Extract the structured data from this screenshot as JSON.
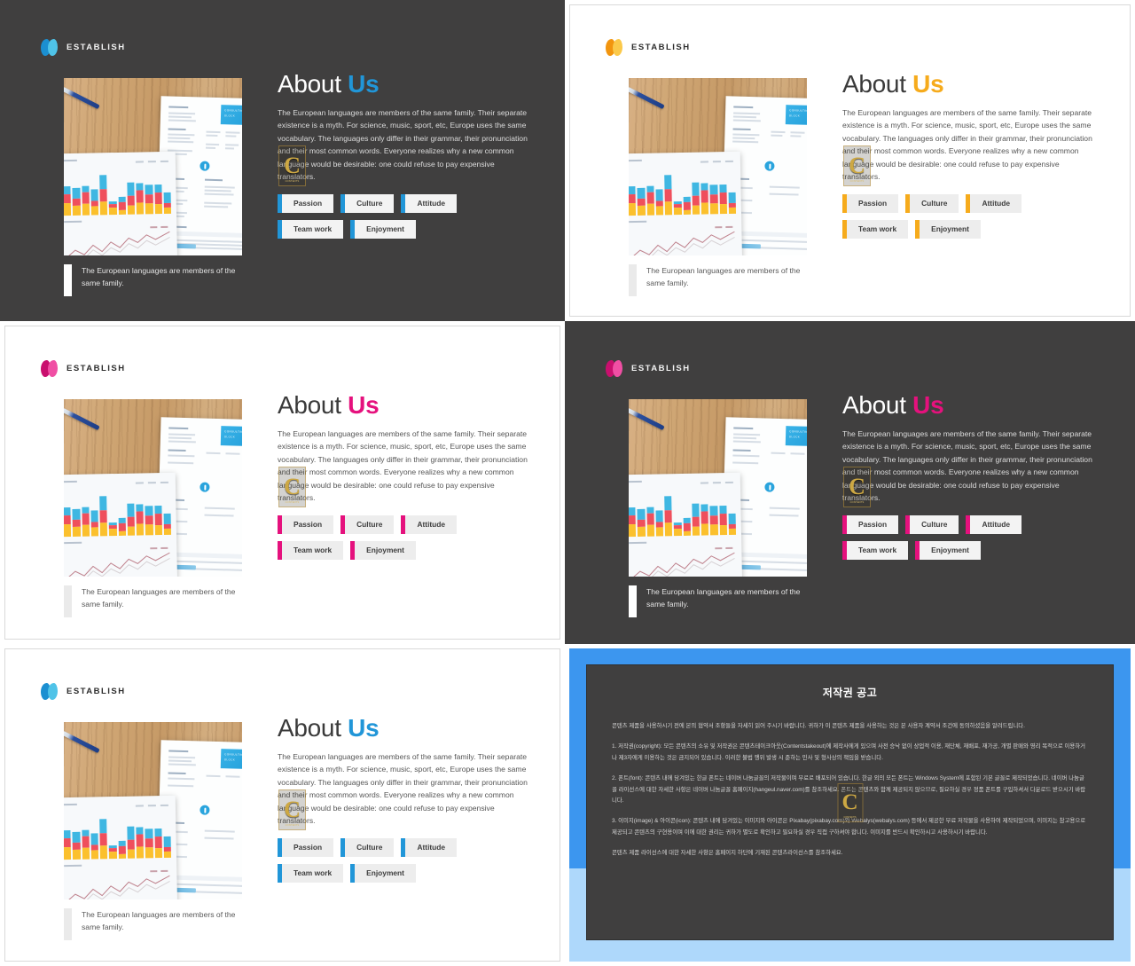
{
  "deck": {
    "brand_name": "ESTABLISH",
    "title_part1": "About ",
    "title_part2": "Us",
    "body_text": "The European languages are members of the same family.  Their separate existence is a myth. For science, music, sport, etc, Europe uses the same vocabulary. The languages only differ in their grammar, their pronunciation and their most common words. Everyone realizes why a new common language would be desirable: one could refuse to pay expensive translators.",
    "caption_text": "The European languages are members of the same family.",
    "chips_row1": [
      "Passion",
      "Culture",
      "Attitude"
    ],
    "chips_row2": [
      "Team work",
      "Enjoyment"
    ],
    "watermark": {
      "glyph": "C",
      "sub": "CONTENTS"
    }
  },
  "slides": [
    {
      "id": "slide-1",
      "theme": "dark",
      "accent": "#2196d8",
      "accent2": "#5ec8e8",
      "position": "top-left"
    },
    {
      "id": "slide-2",
      "theme": "light",
      "accent": "#f6ab1c",
      "accent2": "#fbc94a",
      "position": "top-right"
    },
    {
      "id": "slide-3",
      "theme": "light",
      "accent": "#e5117d",
      "accent2": "#f04fa4",
      "position": "middle-left"
    },
    {
      "id": "slide-4",
      "theme": "dark",
      "accent": "#e5117d",
      "accent2": "#f04fa4",
      "position": "middle-right"
    },
    {
      "id": "slide-5",
      "theme": "light",
      "accent": "#2196d8",
      "accent2": "#5ec8e8",
      "position": "bottom-left"
    }
  ],
  "copyright_slide": {
    "frame_color": "#3c96ef",
    "lower_color": "#aed8fb",
    "panel_color": "#403f3f",
    "title": "저작권 공고",
    "paragraphs": [
      "콘텐츠 제품을 사용하시기 전에 본의 협약서 조항들을 자세히 읽어 주시기 바랍니다. 귀하가 이 콘텐츠 제품을 사용하는 것은 본 사용자 계약서 조건에 동의하셨음을 알려드립니다.",
      "1. 저작권(copyright): 모든 콘텐츠의 소유 및 저작권은 콘텐츠테이크아웃(Contentstakeout)에 제작사에게 있으며 사전 승낙 없이 상업적 이용, 재단체, 재배포, 재가공, 개별 판매와 영리 목적으로 이용하거나 제3자에게 이용하는 것은 금지되어 있습니다. 이러한 불법 행위 발생 시 준하는 민사 및 형사상의 책임을 받습니다.",
      "2. 폰트(font): 콘텐츠 내에 담겨있는 한글 폰트는 네이버 나눔글꼴의 저작물이며 무료로 배포되어 있습니다. 한글 외의 모든 폰트는 Windows System에 포함된 기본 글꼴로 제작되었습니다. 네이버 나눔글꼴 라이선스에 대한 자세한 사항은 네이버 나눔글꼴 홈페이지(hangeul.naver.com)를 참조하세요. 폰트는 콘텐츠와 함께 제공되지 않으므로, 필요하실 경우 정품 폰트를 구입하셔서 다운로드 받으시기 바랍니다.",
      "3. 이미지(image) & 아이콘(icon): 콘텐츠 내에 담겨있는 이미지와 아이콘은 Pixabay(pixabay.com)와 Webalys(webalys.com) 등에서 제공한 무료 저작물을 사용하여 제작되었으며, 이미지는 참고용으로 제공되고 콘텐츠의 구현용이며 이에 대한 권리는 귀하가 별도로 확인하고 필요하실 경우 직접 구하셔야 합니다. 이미지를 반드시 확인하시고 사용하시기 바랍니다.",
      "콘텐츠 제품 라이선스에 대한 자세한 사항은 홈페이지 하단에 기재된 콘텐츠라이선스를 참조하세요."
    ],
    "watermark": {
      "glyph": "C",
      "sub": "CONTENTS"
    }
  },
  "photo": {
    "alt": "wooden-desk-with-report-and-bar-chart-printouts",
    "bar_chart": {
      "type": "bar",
      "series": [
        {
          "name": "yellow",
          "color": "#fbc02d",
          "values": [
            14,
            11,
            13,
            10,
            15,
            8,
            5,
            10,
            13,
            12,
            11,
            7
          ]
        },
        {
          "name": "red",
          "color": "#ef4f5c",
          "values": [
            10,
            8,
            13,
            6,
            14,
            4,
            9,
            11,
            14,
            10,
            13,
            5
          ]
        },
        {
          "name": "cyan",
          "color": "#3fb7e2",
          "values": [
            9,
            12,
            7,
            13,
            16,
            3,
            6,
            15,
            8,
            11,
            9,
            12
          ]
        }
      ]
    },
    "line_chart": {
      "type": "line",
      "points": [
        8,
        14,
        10,
        18,
        13,
        20,
        16,
        24,
        21,
        27,
        23,
        30
      ]
    }
  }
}
